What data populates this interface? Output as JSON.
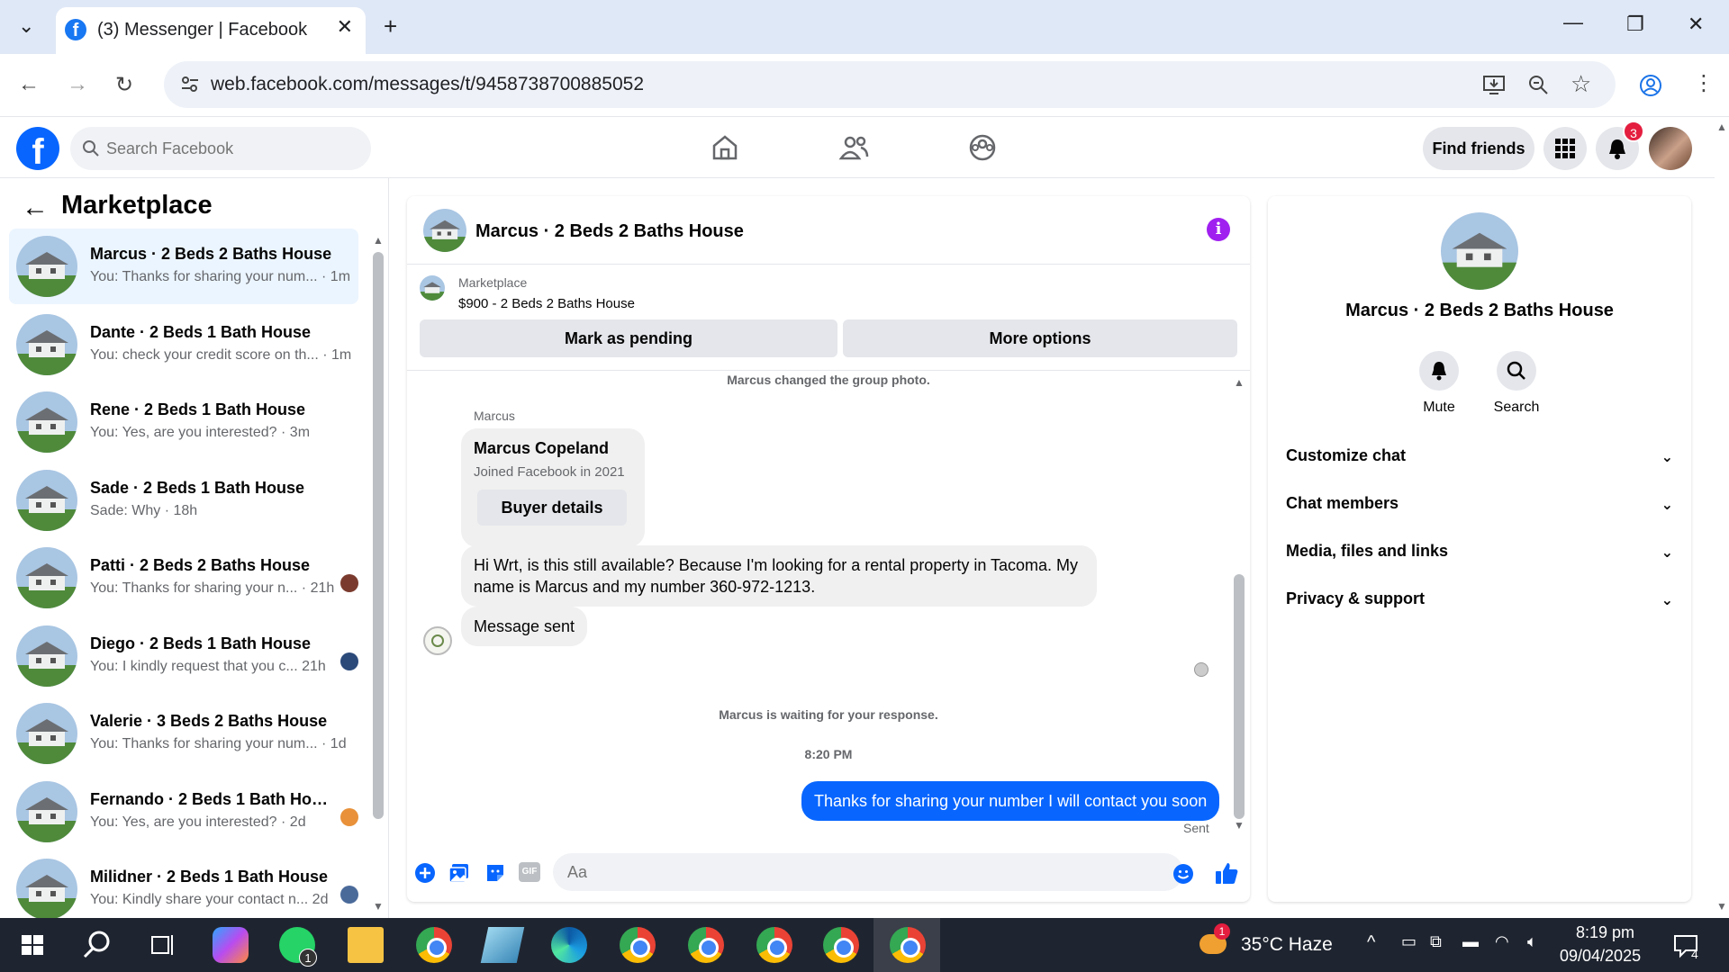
{
  "browser": {
    "tab_title": "(3) Messenger | Facebook",
    "url": "web.facebook.com/messages/t/9458738700885052",
    "new_tab_symbol": "+"
  },
  "fb": {
    "search_placeholder": "Search Facebook",
    "find_friends": "Find friends",
    "notification_count": "3"
  },
  "sidebar": {
    "heading": "Marketplace",
    "conversations": [
      {
        "name": "Marcus · 2 Beds 2 Baths House",
        "preview": "You: Thanks for sharing your num... · 1m",
        "active": true
      },
      {
        "name": "Dante · 2 Beds 1 Bath House",
        "preview": "You: check your credit score on th... · 1m"
      },
      {
        "name": "Rene · 2 Beds 1 Bath House",
        "preview": "You: Yes, are you interested? · 3m"
      },
      {
        "name": "Sade · 2 Beds 1 Bath House",
        "preview": "Sade: Why · 18h"
      },
      {
        "name": "Patti · 2 Beds 2 Baths House",
        "preview": "You: Thanks for sharing your n... · 21h"
      },
      {
        "name": "Diego · 2 Beds 1 Bath House",
        "preview": "You: I kindly request that you c... 21h"
      },
      {
        "name": "Valerie · 3 Beds 2 Baths House",
        "preview": "You: Thanks for sharing your num... · 1d"
      },
      {
        "name": "Fernando · 2 Beds 1 Bath Hou...",
        "preview": "You: Yes, are you interested? · 2d"
      },
      {
        "name": "Milidner · 2 Beds 1 Bath House",
        "preview": "You: Kindly share your contact n... 2d"
      }
    ]
  },
  "chat": {
    "title": "Marcus · 2 Beds 2 Baths House",
    "marketplace_label": "Marketplace",
    "listing": "$900 - 2 Beds 2 Baths House",
    "mark_pending": "Mark as pending",
    "more_options": "More options",
    "sys_photo": "Marcus changed the group photo.",
    "sender": "Marcus",
    "card_name": "Marcus Copeland",
    "card_joined": "Joined Facebook in 2021",
    "buyer_details": "Buyer details",
    "msg1": "Hi Wrt, is this still available? Because I'm looking for a rental property in Tacoma. My name is Marcus and my number 360-972-1213.",
    "msg2": "Message sent",
    "waiting": "Marcus is waiting for your response.",
    "time": "8:20 PM",
    "outgoing": "Thanks for sharing your number I will contact you soon",
    "sent_status": "Sent",
    "input_placeholder": "Aa",
    "gif_label": "GIF"
  },
  "rpanel": {
    "title": "Marcus · 2 Beds 2 Baths House",
    "mute": "Mute",
    "search": "Search",
    "sections": [
      "Customize chat",
      "Chat members",
      "Media, files and links",
      "Privacy & support"
    ]
  },
  "taskbar": {
    "weather": "35°C  Haze",
    "time": "8:19 pm",
    "date": "09/04/2025",
    "whatsapp_badge": "1",
    "notif_count": "4",
    "weather_badge": "1"
  },
  "colors": {
    "fb_blue": "#0866ff",
    "info_purple": "#a020f0",
    "badge_red": "#e41e3f"
  }
}
